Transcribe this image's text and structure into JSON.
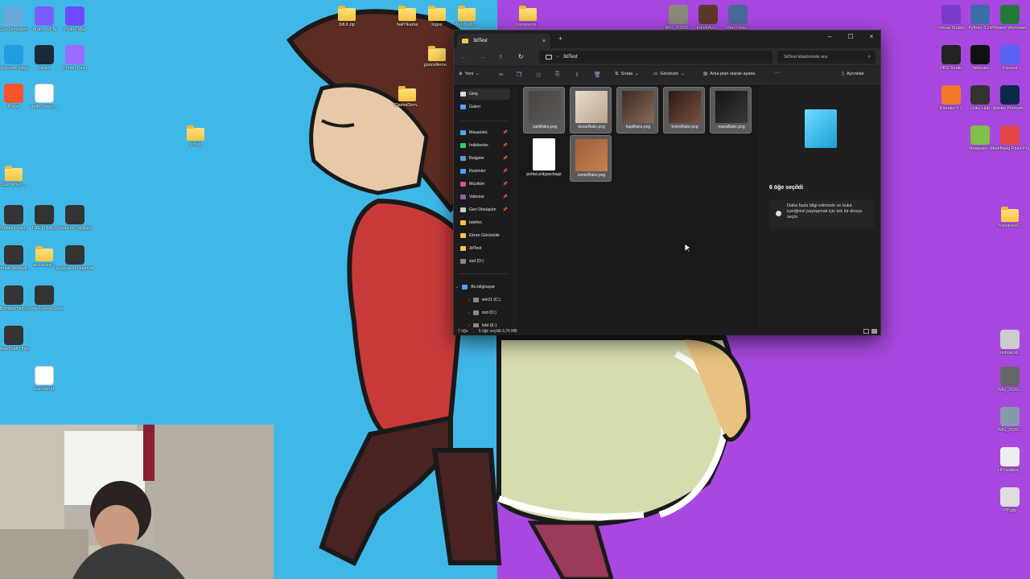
{
  "desktop": {
    "left_icons": [
      {
        "label": "Geri Dönüşüm",
        "kind": "recycle"
      },
      {
        "label": "Proton VPN",
        "kind": "vpn"
      },
      {
        "label": "Proton Mail",
        "kind": "mail"
      },
      {
        "label": "Microsoft Edge",
        "kind": "edge"
      },
      {
        "label": "Steam",
        "kind": "steam"
      },
      {
        "label": "Proton Pass",
        "kind": "pass"
      },
      {
        "label": "Brave",
        "kind": "brave"
      },
      {
        "label": "abtlfr_mech...",
        "kind": "doc"
      },
      {
        "label": "3dTest",
        "kind": "folder"
      },
      {
        "label": "ClaimsDem...",
        "kind": "folder"
      },
      {
        "label": "Zombie Road...",
        "kind": "game"
      },
      {
        "label": "THE FINALS",
        "kind": "game"
      },
      {
        "label": "Dead by Daylight",
        "kind": "game"
      },
      {
        "label": "Zombie Assault...",
        "kind": "game"
      },
      {
        "label": "aks.anasi...",
        "kind": "folder"
      },
      {
        "label": "League of Legends",
        "kind": "game"
      },
      {
        "label": "Bomberman...",
        "kind": "game"
      },
      {
        "label": "Goose Goose Duck",
        "kind": "game"
      },
      {
        "label": "DeadCraft Unity",
        "kind": "game"
      },
      {
        "label": "test.blend",
        "kind": "blender"
      }
    ],
    "top_icons": [
      {
        "label": "3dUI.zip"
      },
      {
        "label": "haliYikama"
      },
      {
        "label": "logos"
      },
      {
        "label": "darkmagic..."
      },
      {
        "label": "güncelleme..."
      },
      {
        "label": "ClaimsDem..."
      },
      {
        "label": "tusvarensi..."
      },
      {
        "label": "IMG_20250..."
      },
      {
        "label": "ErkekAvci..."
      },
      {
        "label": "MarcoStar..."
      }
    ],
    "right_icons": [
      {
        "label": "Visual Studio"
      },
      {
        "label": "Python 3.14"
      },
      {
        "label": "VMware Workstati..."
      },
      {
        "label": "OBS Studio"
      },
      {
        "label": "Tailscale"
      },
      {
        "label": "Discord"
      },
      {
        "label": "Blender 5.2"
      },
      {
        "label": "Unity Hub"
      },
      {
        "label": "Adobe Photosh..."
      },
      {
        "label": "Notepad++"
      },
      {
        "label": "MediBang Paint Pro"
      },
      {
        "label": "TusvaresS..."
      },
      {
        "label": "trishow.st..."
      },
      {
        "label": "IMG_2020..."
      },
      {
        "label": "IMG_2020..."
      },
      {
        "label": "HD-wallpa..."
      },
      {
        "label": "PP.jpg"
      }
    ]
  },
  "explorer": {
    "tab_title": "3dTest",
    "close_tab": "×",
    "new_tab": "+",
    "window_controls": {
      "minimize": "–",
      "maximize": "☐",
      "close": "×"
    },
    "address": {
      "chevron": "›",
      "path": "3dTest"
    },
    "search_placeholder": "3dTest klasöründe ara",
    "toolbar": {
      "new_label": "Yeni",
      "sort_label": "Sırala",
      "view_label": "Görünüm",
      "background_label": "Arka plan olarak ayarla",
      "more_label": "···",
      "details_label": "Ayrıntılar"
    },
    "sidebar": [
      {
        "label": "Giriş",
        "icon": "home-icon",
        "pinned": false,
        "color": "#dddddd"
      },
      {
        "label": "Galeri",
        "icon": "gallery-icon",
        "pinned": false,
        "color": "#4da3ff"
      },
      {
        "label": "Masaüstü",
        "icon": "desktop-icon",
        "pinned": true,
        "color": "#4da3ff"
      },
      {
        "label": "İndirilenler",
        "icon": "download-icon",
        "pinned": true,
        "color": "#2ecc71"
      },
      {
        "label": "Belgeler",
        "icon": "documents-icon",
        "pinned": true,
        "color": "#5b9bd5"
      },
      {
        "label": "Resimler",
        "icon": "pictures-icon",
        "pinned": true,
        "color": "#4da3ff"
      },
      {
        "label": "Müzikler",
        "icon": "music-icon",
        "pinned": true,
        "color": "#e0509a"
      },
      {
        "label": "Videolar",
        "icon": "videos-icon",
        "pinned": true,
        "color": "#9b59b6"
      },
      {
        "label": "Geri Dönüşüm",
        "icon": "recycle-icon",
        "pinned": true,
        "color": "#cccccc"
      },
      {
        "label": "telefon",
        "icon": "folder-icon",
        "pinned": false,
        "color": "#f5c542"
      },
      {
        "label": "Ekran Görüntüle",
        "icon": "folder-icon",
        "pinned": false,
        "color": "#f5c542"
      },
      {
        "label": "3dTest",
        "icon": "folder-icon",
        "pinned": false,
        "color": "#f5c542"
      },
      {
        "label": "ssd (D:)",
        "icon": "drive-icon",
        "pinned": false,
        "color": "#888888"
      },
      {
        "label": "Bu bilgisayar",
        "icon": "pc-icon",
        "pinned": false,
        "color": "#4da3ff"
      },
      {
        "label": "win11 (C:)",
        "icon": "drive-icon",
        "pinned": false,
        "color": "#888888"
      },
      {
        "label": "ssd (D:)",
        "icon": "drive-icon",
        "pinned": false,
        "color": "#888888"
      },
      {
        "label": "hdd (E:)",
        "icon": "drive-icon",
        "pinned": false,
        "color": "#888888"
      }
    ],
    "files": [
      {
        "name": "camBake.png",
        "selected": true,
        "swatch": [
          "#4a4644",
          "#5c5855"
        ]
      },
      {
        "name": "duvarBake.png",
        "selected": true,
        "swatch": [
          "#e9ddd0",
          "#b8a48c"
        ]
      },
      {
        "name": "kapiBake.png",
        "selected": true,
        "swatch": [
          "#3a2c25",
          "#8a6a55"
        ]
      },
      {
        "name": "kolonBake.png",
        "selected": true,
        "swatch": [
          "#2a1a14",
          "#7a5040"
        ]
      },
      {
        "name": "masaBake.png",
        "selected": true,
        "swatch": [
          "#141414",
          "#3a3a3a"
        ]
      },
      {
        "name": "portal.unitypackage",
        "selected": false,
        "swatch": [
          "#ffffff",
          "#e6e6e6"
        ]
      },
      {
        "name": "zeminBake.png",
        "selected": true,
        "swatch": [
          "#a0603a",
          "#c77f50"
        ]
      }
    ],
    "details_pane": {
      "selection_title": "6 öğe seçildi",
      "info_text": "Daha fazla bilgi edinmek ve bulut içeriğinizi paylaşmak için tek bir dosya seçin."
    },
    "status": {
      "items": "7 öğe",
      "selected": "6 öğe seçildi  3,76 MB"
    }
  }
}
